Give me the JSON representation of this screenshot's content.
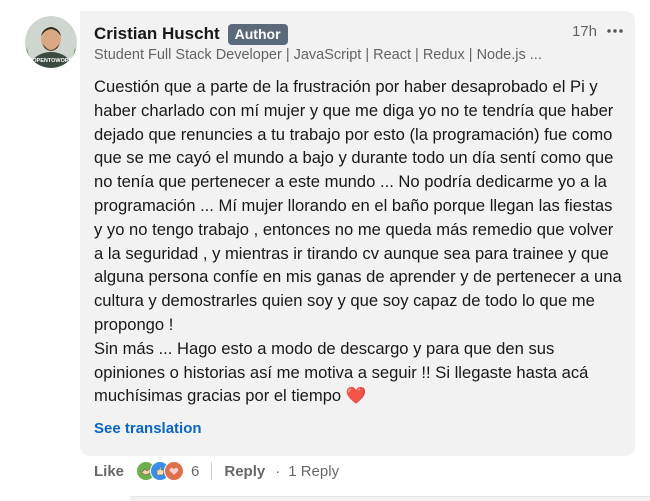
{
  "comment": {
    "author": {
      "name": "Cristian Huscht",
      "badge": "Author",
      "headline": "Student Full Stack Developer | JavaScript | React | Redux | Node.js ...",
      "avatar_ring_text": "#OPENTOWORK"
    },
    "timestamp": "17h",
    "text": "Cuestión que a parte de la frustración por haber desaprobado el Pi y haber charlado con mí mujer y que me diga yo no te tendría que haber dejado que renuncies a tu trabajo por esto (la programación) fue como que se me cayó el mundo a bajo y durante todo un día sentí como que no tenía que pertenecer a este mundo ... No podría dedicarme yo a la programación ... Mí mujer llorando en el baño porque llegan las fiestas y yo no tengo trabajo , entonces no me queda más remedio que volver a la seguridad , y mientras ir tirando cv aunque sea para trainee y que alguna persona confíe en mis ganas de aprender y de pertenecer a una cultura y demostrarles quien soy y que soy capaz de todo lo que me propongo !\nSin más ... Hago esto a modo de descargo y para que den sus opiniones o historias así me motiva a seguir !! Si llegaste hasta acá muchísimas gracias por el tiempo ❤️",
    "see_translation": "See translation"
  },
  "actions": {
    "like_label": "Like",
    "reaction_icons": [
      "support-icon",
      "like-icon",
      "love-icon"
    ],
    "reaction_count": "6",
    "reply_label": "Reply",
    "dot": "·",
    "reply_count": "1 Reply"
  },
  "colors": {
    "bubble": "#f2f2f2",
    "badge": "#5b6a7b",
    "link": "#0a66c2",
    "open_to_work": "#3b7a2a"
  }
}
